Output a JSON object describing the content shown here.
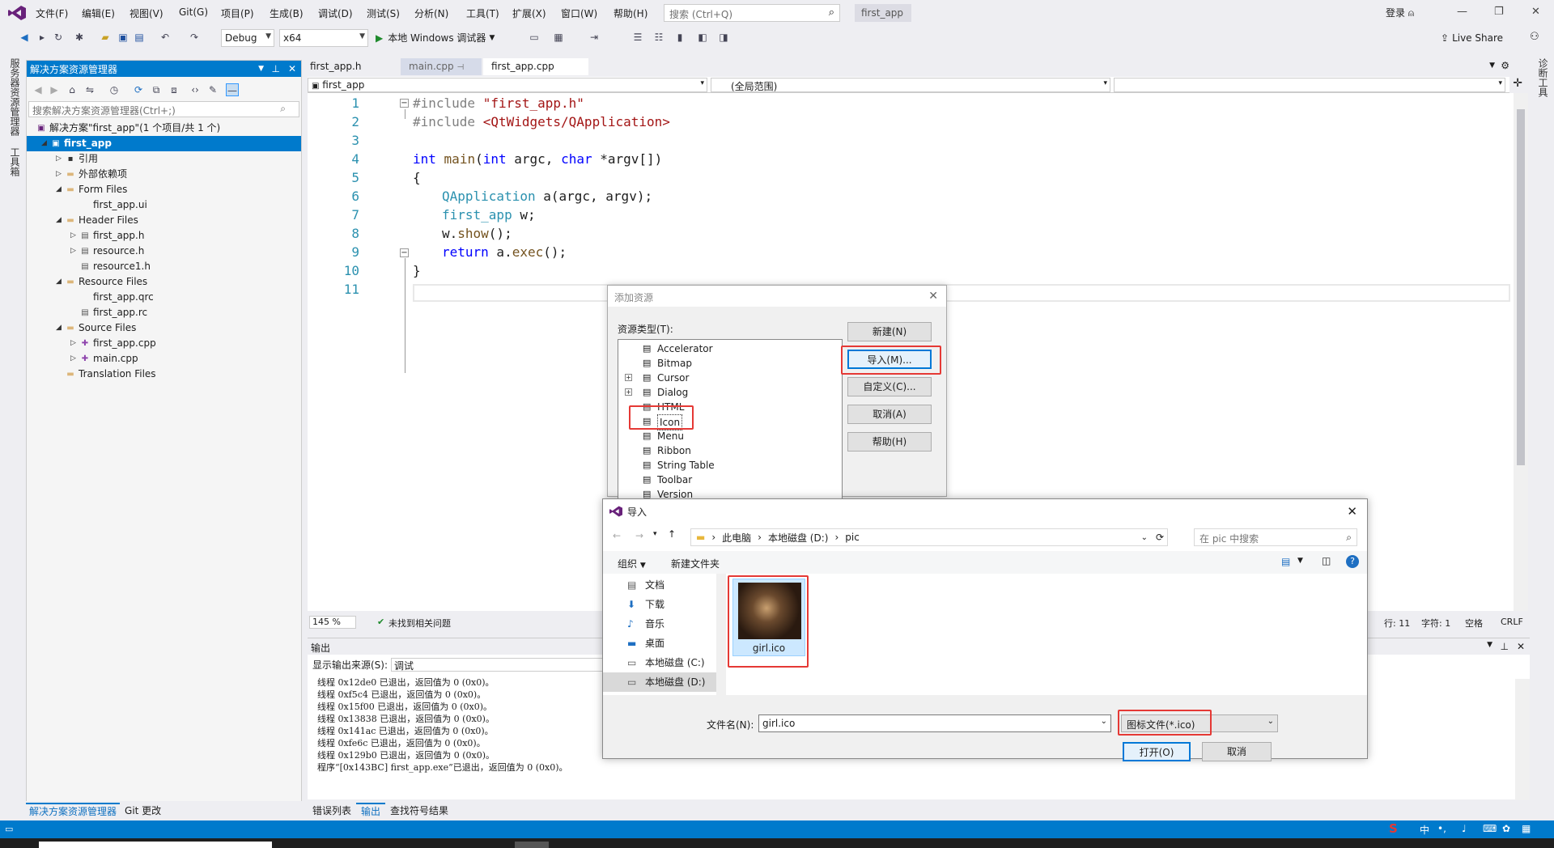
{
  "menubar": {
    "items": [
      "文件(F)",
      "编辑(E)",
      "视图(V)",
      "Git(G)",
      "项目(P)",
      "生成(B)",
      "调试(D)",
      "测试(S)",
      "分析(N)",
      "工具(T)",
      "扩展(X)",
      "窗口(W)",
      "帮助(H)"
    ],
    "search_placeholder": "搜索 (Ctrl+Q)",
    "solution_name": "first_app",
    "login": "登录"
  },
  "toolbar": {
    "config": "Debug",
    "platform": "x64",
    "run_label": "本地 Windows 调试器",
    "live_share": "Live Share"
  },
  "vstrip": {
    "items": [
      "服务器资源管理器",
      "工具箱"
    ]
  },
  "right_strip": {
    "label": "诊断工具"
  },
  "solution_explorer": {
    "title": "解决方案资源管理器",
    "search_placeholder": "搜索解决方案资源管理器(Ctrl+;)",
    "tree": [
      {
        "label": "解决方案\"first_app\"(1 个项目/共 1 个)",
        "level": 0,
        "exp": "",
        "icon": "solution-icon"
      },
      {
        "label": "first_app",
        "level": 1,
        "exp": "◢",
        "icon": "project-icon",
        "selected": true
      },
      {
        "label": "引用",
        "level": 2,
        "exp": "▷",
        "icon": "references-icon"
      },
      {
        "label": "外部依赖项",
        "level": 2,
        "exp": "▷",
        "icon": "folder-icon"
      },
      {
        "label": "Form Files",
        "level": 2,
        "exp": "◢",
        "icon": "folder-icon"
      },
      {
        "label": "first_app.ui",
        "level": 3,
        "exp": "",
        "icon": ""
      },
      {
        "label": "Header Files",
        "level": 2,
        "exp": "◢",
        "icon": "folder-icon"
      },
      {
        "label": "first_app.h",
        "level": 3,
        "exp": "▷",
        "icon": "header-file-icon"
      },
      {
        "label": "resource.h",
        "level": 3,
        "exp": "▷",
        "icon": "header-file-icon"
      },
      {
        "label": "resource1.h",
        "level": 3,
        "exp": "",
        "icon": "header-file-icon"
      },
      {
        "label": "Resource Files",
        "level": 2,
        "exp": "◢",
        "icon": "folder-icon"
      },
      {
        "label": "first_app.qrc",
        "level": 3,
        "exp": "",
        "icon": ""
      },
      {
        "label": "first_app.rc",
        "level": 3,
        "exp": "",
        "icon": "rc-file-icon"
      },
      {
        "label": "Source Files",
        "level": 2,
        "exp": "◢",
        "icon": "folder-icon"
      },
      {
        "label": "first_app.cpp",
        "level": 3,
        "exp": "▷",
        "icon": "cpp-file-icon"
      },
      {
        "label": "main.cpp",
        "level": 3,
        "exp": "▷",
        "icon": "cpp-file-icon"
      },
      {
        "label": "Translation Files",
        "level": 2,
        "exp": "",
        "icon": "folder-icon"
      }
    ],
    "bottom_tabs": [
      "解决方案资源管理器",
      "Git 更改"
    ]
  },
  "editor": {
    "tabs": [
      "first_app.h",
      "main.cpp",
      "first_app.cpp"
    ],
    "nav_project": "first_app",
    "nav_scope": "(全局范围)",
    "zoom": "145 %",
    "issues": "未找到相关问题",
    "line": "行: 11",
    "col": "字符: 1",
    "spaces": "空格",
    "eol": "CRLF",
    "line_numbers": [
      "1",
      "2",
      "3",
      "4",
      "5",
      "6",
      "7",
      "8",
      "9",
      "10",
      "11"
    ]
  },
  "output": {
    "title": "输出",
    "source_label": "显示输出来源(S):",
    "source_value": "调试",
    "lines": [
      "线程 0x12de0 已退出，返回值为 0 (0x0)。",
      "线程 0xf5c4 已退出，返回值为 0 (0x0)。",
      "线程 0x15f00 已退出，返回值为 0 (0x0)。",
      "线程 0x13838 已退出，返回值为 0 (0x0)。",
      "线程 0x141ac 已退出，返回值为 0 (0x0)。",
      "线程 0xfe6c 已退出，返回值为 0 (0x0)。",
      "线程 0x129b0 已退出，返回值为 0 (0x0)。",
      "程序“[0x143BC] first_app.exe”已退出，返回值为 0 (0x0)。"
    ],
    "bottom_tabs": [
      "错误列表",
      "输出",
      "查找符号结果"
    ]
  },
  "add_resource": {
    "title": "添加资源",
    "type_label": "资源类型(T):",
    "types": [
      "Accelerator",
      "Bitmap",
      "Cursor",
      "Dialog",
      "HTML",
      "Icon",
      "Menu",
      "Ribbon",
      "String Table",
      "Toolbar",
      "Version"
    ],
    "buttons": {
      "new": "新建(N)",
      "import": "导入(M)...",
      "custom": "自定义(C)...",
      "cancel": "取消(A)",
      "help": "帮助(H)"
    }
  },
  "import_dialog": {
    "title": "导入",
    "path": [
      "此电脑",
      "本地磁盘 (D:)",
      "pic"
    ],
    "search_placeholder": "在 pic 中搜索",
    "organize": "组织",
    "new_folder": "新建文件夹",
    "nav": [
      "文档",
      "下载",
      "音乐",
      "桌面",
      "本地磁盘 (C:)",
      "本地磁盘 (D:)"
    ],
    "file_name_thumb": "girl.ico",
    "filename_label": "文件名(N):",
    "filename_value": "girl.ico",
    "filter": "图标文件(*.ico)",
    "open": "打开(O)",
    "cancel": "取消"
  }
}
